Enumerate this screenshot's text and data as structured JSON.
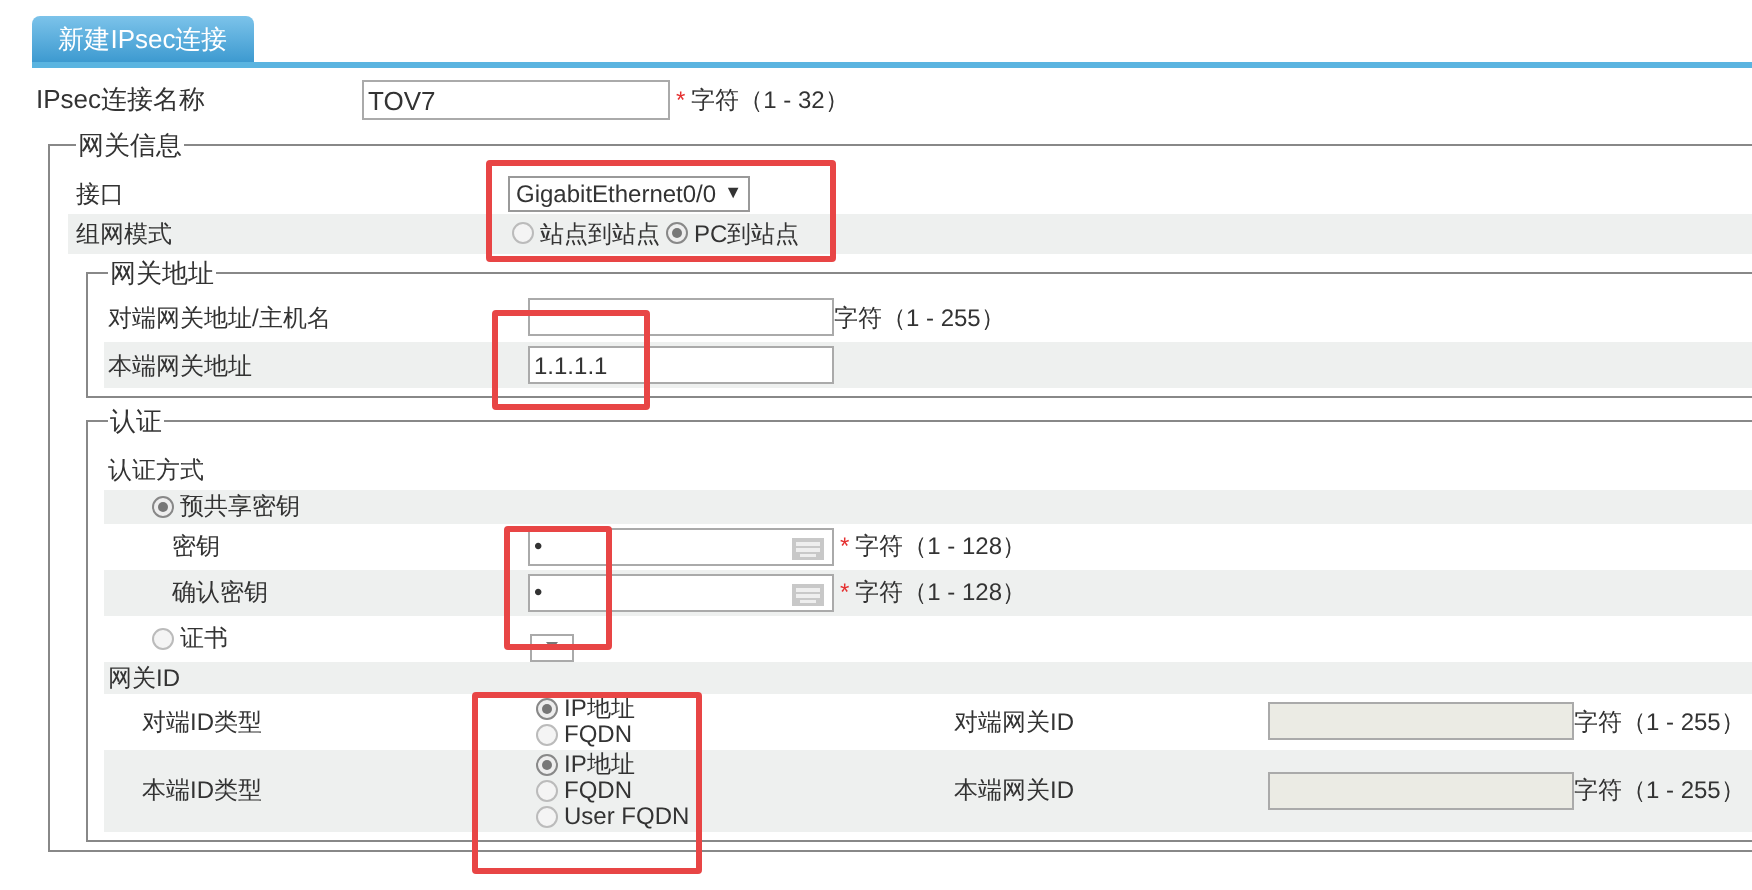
{
  "tab": {
    "label": "新建IPsec连接",
    "selected": true
  },
  "name_row": {
    "label": "IPsec连接名称",
    "value": "TOV7",
    "required_mark": "*",
    "hint": "字符（1 - 32）"
  },
  "gateway_info": {
    "legend": "网关信息",
    "interface": {
      "label": "接口",
      "value": "GigabitEthernet0/0",
      "arrow": "▼"
    },
    "mode": {
      "label": "组网模式",
      "options": [
        {
          "label": "站点到站点",
          "selected": false
        },
        {
          "label": "PC到站点",
          "selected": true
        }
      ]
    },
    "gateway_address": {
      "legend": "网关地址",
      "rows": [
        {
          "label": "对端网关地址/主机名",
          "hint": "字符（1 - 255）"
        },
        {
          "label": "本端网关地址",
          "value": "1.1.1.1"
        }
      ]
    },
    "auth": {
      "legend": "认证",
      "method_label": "认证方式",
      "psk": {
        "label": "预共享密钥",
        "selected": true
      },
      "key_rows": [
        {
          "label": "密钥",
          "value": "•",
          "required_mark": "*",
          "hint": "字符（1 - 128）"
        },
        {
          "label": "确认密钥",
          "value": "•",
          "required_mark": "*",
          "hint": "字符（1 - 128）"
        }
      ],
      "cert": {
        "label": "证书",
        "selected": false
      },
      "gateway_id": {
        "title": "网关ID",
        "rows": [
          {
            "type_label": "对端ID类型",
            "options": [
              {
                "label": "IP地址",
                "selected": true
              },
              {
                "label": "FQDN",
                "selected": false
              }
            ],
            "id_label": "对端网关ID",
            "disabled": true,
            "hint": "字符（1 - 255）"
          },
          {
            "type_label": "本端ID类型",
            "options": [
              {
                "label": "IP地址",
                "selected": true
              },
              {
                "label": "FQDN",
                "selected": false
              },
              {
                "label": "User FQDN",
                "selected": false
              }
            ],
            "id_label": "本端网关ID",
            "disabled": true,
            "hint": "字符（1 - 255）"
          }
        ]
      }
    }
  }
}
